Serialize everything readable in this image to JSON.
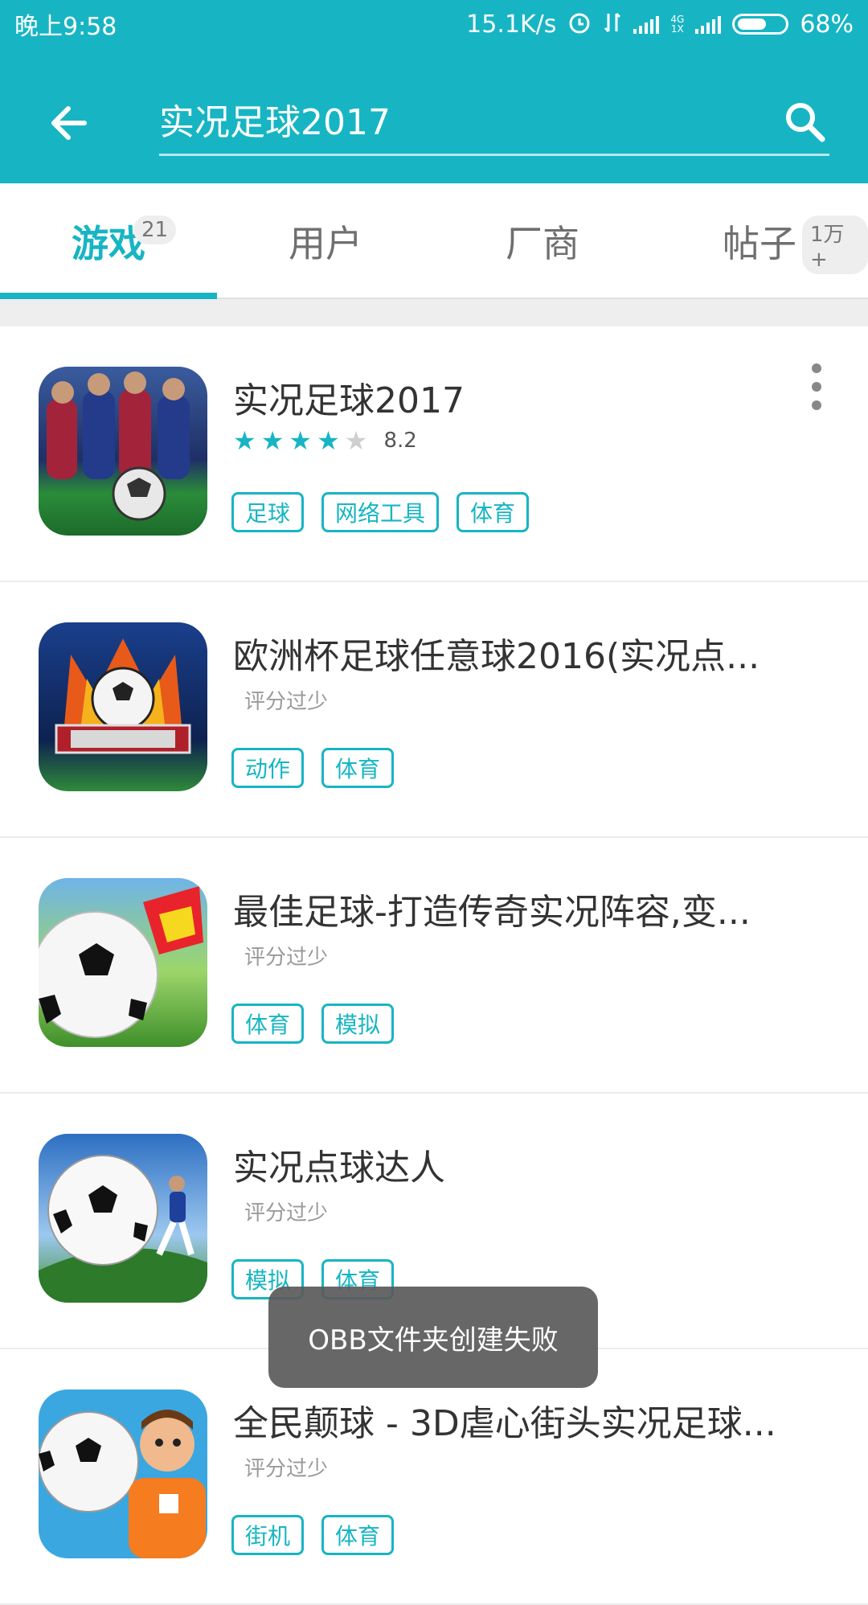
{
  "status_bar": {
    "time": "晚上9:58",
    "net_speed": "15.1K/s",
    "net_type_top": "4G",
    "net_type_bottom": "1X",
    "battery_percent": "68%",
    "battery_level": 0.68,
    "icons": [
      "alarm-icon",
      "data-arrows-icon",
      "signal-icon",
      "battery-icon"
    ]
  },
  "app_bar": {
    "search_query": "实况足球2017",
    "back_icon": "arrow-left-icon",
    "search_icon": "search-icon"
  },
  "tabs": [
    {
      "label": "游戏",
      "badge": "21",
      "active": true
    },
    {
      "label": "用户",
      "badge": "",
      "active": false
    },
    {
      "label": "厂商",
      "badge": "",
      "active": false
    },
    {
      "label": "帖子",
      "badge": "1万+",
      "active": false
    }
  ],
  "accent_color": "#17b5c3",
  "results": [
    {
      "title": "实况足球2017",
      "rating": "8.2",
      "stars_filled": 4,
      "stars_total": 5,
      "tags": [
        "足球",
        "网络工具",
        "体育"
      ],
      "has_more_menu": true
    },
    {
      "title": "欧洲杯足球任意球2016(实况点...",
      "rating_text": "评分过少",
      "tags": [
        "动作",
        "体育"
      ]
    },
    {
      "title": "最佳足球-打造传奇实况阵容,变...",
      "rating_text": "评分过少",
      "tags": [
        "体育",
        "模拟"
      ]
    },
    {
      "title": "实况点球达人",
      "rating_text": "评分过少",
      "tags": [
        "模拟",
        "体育"
      ]
    },
    {
      "title": "全民颠球 - 3D虐心街头实况足球...",
      "rating_text": "评分过少",
      "tags": [
        "街机",
        "体育"
      ]
    }
  ],
  "toast": "OBB文件夹创建失败"
}
